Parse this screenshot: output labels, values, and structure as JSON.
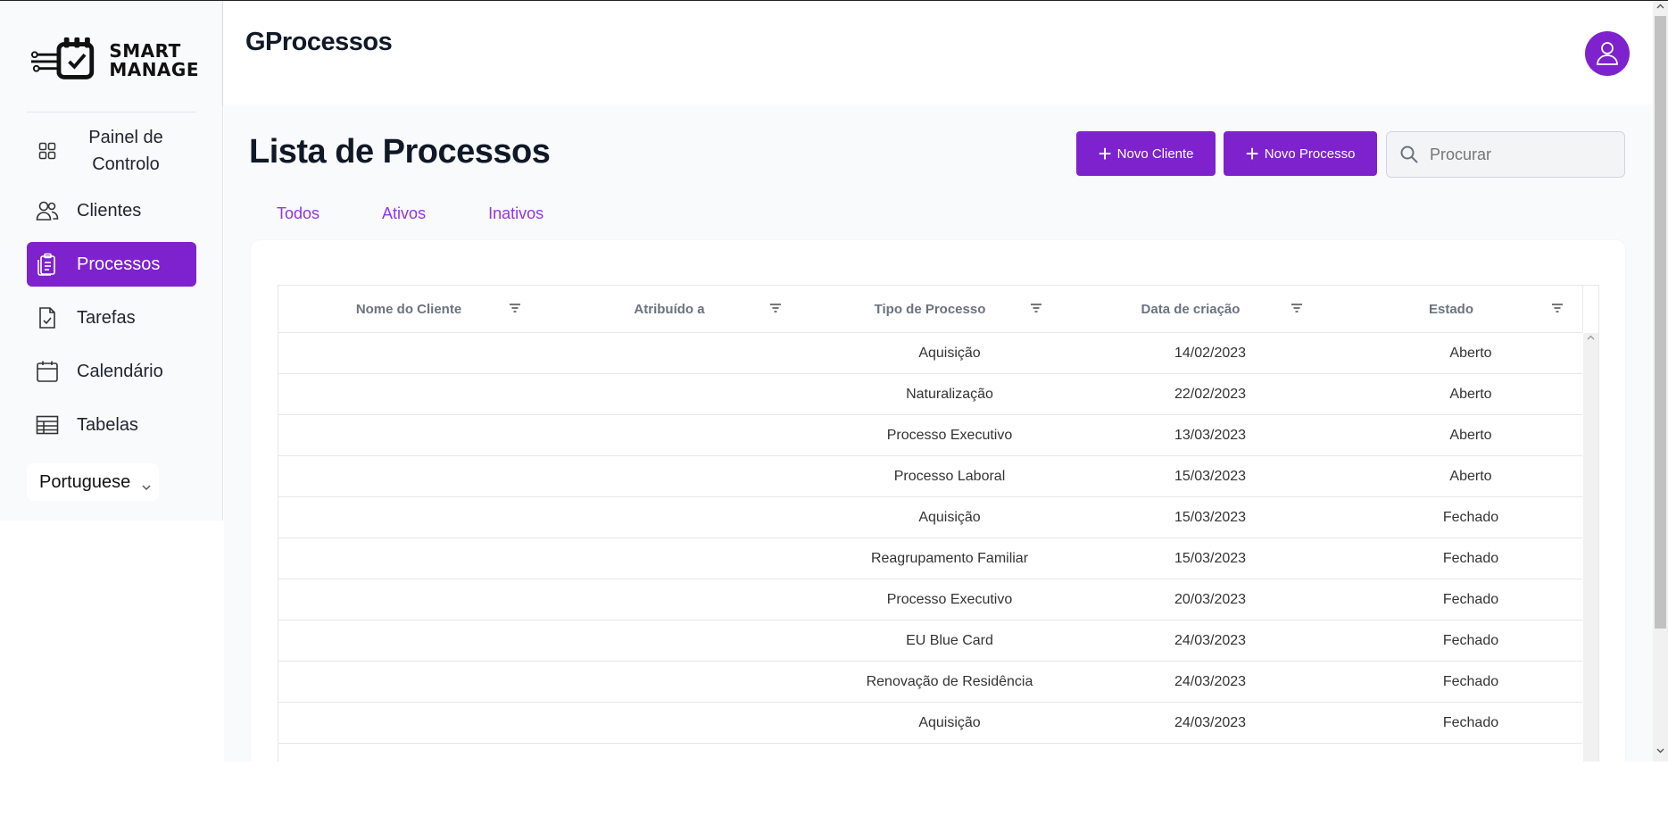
{
  "app": {
    "title": "GProcessos",
    "logo_line1": "SMART",
    "logo_line2": "MANAGE"
  },
  "sidebar": {
    "items": [
      {
        "label": "Painel de Controlo",
        "icon": "dashboard-grid-icon",
        "active": false
      },
      {
        "label": "Clientes",
        "icon": "users-icon",
        "active": false
      },
      {
        "label": "Processos",
        "icon": "clipboard-icon",
        "active": true
      },
      {
        "label": "Tarefas",
        "icon": "file-check-icon",
        "active": false
      },
      {
        "label": "Calendário",
        "icon": "calendar-icon",
        "active": false
      },
      {
        "label": "Tabelas",
        "icon": "table-icon",
        "active": false
      }
    ],
    "language": "Portuguese"
  },
  "main": {
    "page_title": "Lista de Processos",
    "new_client_label": "Novo Cliente",
    "new_process_label": "Novo Processo",
    "search_placeholder": "Procurar",
    "tabs": [
      "Todos",
      "Ativos",
      "Inativos"
    ]
  },
  "table": {
    "columns": [
      "Nome do Cliente",
      "Atribuído a",
      "Tipo de Processo",
      "Data de criação",
      "Estado"
    ],
    "rows": [
      [
        "",
        "",
        "Aquisição",
        "14/02/2023",
        "Aberto"
      ],
      [
        "",
        "",
        "Naturalização",
        "22/02/2023",
        "Aberto"
      ],
      [
        "",
        "",
        "Processo Executivo",
        "13/03/2023",
        "Aberto"
      ],
      [
        "",
        "",
        "Processo Laboral",
        "15/03/2023",
        "Aberto"
      ],
      [
        "",
        "",
        "Aquisição",
        "15/03/2023",
        "Fechado"
      ],
      [
        "",
        "",
        "Reagrupamento Familiar",
        "15/03/2023",
        "Fechado"
      ],
      [
        "",
        "",
        "Processo Executivo",
        "20/03/2023",
        "Fechado"
      ],
      [
        "",
        "",
        "EU Blue Card",
        "24/03/2023",
        "Fechado"
      ],
      [
        "",
        "",
        "Renovação de Residência",
        "24/03/2023",
        "Fechado"
      ],
      [
        "",
        "",
        "Aquisição",
        "24/03/2023",
        "Fechado"
      ]
    ]
  },
  "colors": {
    "accent": "#7e22ce",
    "tab_text": "#9333ea",
    "background": "#f9fafb"
  }
}
